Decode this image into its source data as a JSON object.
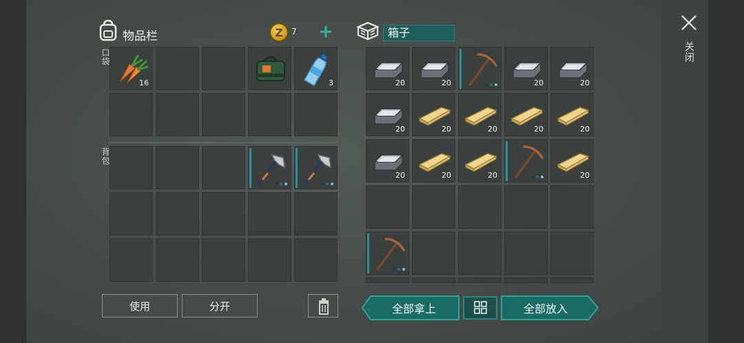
{
  "inventory": {
    "title": "物品栏",
    "coins": "7",
    "pocket_label": "口袋",
    "backpack_label": "背包",
    "pocket": [
      {
        "item": "carrot",
        "count": "16"
      },
      {
        "item": "",
        "count": ""
      },
      {
        "item": "",
        "count": ""
      },
      {
        "item": "supply-bag",
        "count": ""
      },
      {
        "item": "water-bottle",
        "count": "3"
      },
      {
        "item": "",
        "count": ""
      },
      {
        "item": "",
        "count": ""
      },
      {
        "item": "",
        "count": ""
      },
      {
        "item": "",
        "count": ""
      },
      {
        "item": "",
        "count": ""
      }
    ],
    "backpack": [
      {
        "item": "",
        "count": ""
      },
      {
        "item": "",
        "count": ""
      },
      {
        "item": "",
        "count": ""
      },
      {
        "item": "hatchet",
        "count": "",
        "durability": true
      },
      {
        "item": "hatchet",
        "count": "",
        "durability": true
      },
      {
        "item": "",
        "count": ""
      },
      {
        "item": "",
        "count": ""
      },
      {
        "item": "",
        "count": ""
      },
      {
        "item": "",
        "count": ""
      },
      {
        "item": "",
        "count": ""
      },
      {
        "item": "",
        "count": ""
      },
      {
        "item": "",
        "count": ""
      },
      {
        "item": "",
        "count": ""
      },
      {
        "item": "",
        "count": ""
      },
      {
        "item": "",
        "count": ""
      }
    ],
    "use_label": "使用",
    "split_label": "分开"
  },
  "box": {
    "name": "箱子",
    "slots": [
      {
        "item": "iron-ingot",
        "count": "20"
      },
      {
        "item": "iron-ingot",
        "count": "20"
      },
      {
        "item": "pickaxe",
        "count": "",
        "durability": true
      },
      {
        "item": "iron-ingot",
        "count": "20"
      },
      {
        "item": "iron-ingot",
        "count": "20"
      },
      {
        "item": "iron-ingot",
        "count": "20"
      },
      {
        "item": "plank",
        "count": "20"
      },
      {
        "item": "plank",
        "count": "20"
      },
      {
        "item": "plank",
        "count": "20"
      },
      {
        "item": "plank",
        "count": "20"
      },
      {
        "item": "iron-ingot",
        "count": "20"
      },
      {
        "item": "plank",
        "count": "20"
      },
      {
        "item": "plank",
        "count": "20"
      },
      {
        "item": "pickaxe",
        "count": "",
        "durability": true
      },
      {
        "item": "plank",
        "count": "20"
      },
      {
        "item": "",
        "count": ""
      },
      {
        "item": "",
        "count": ""
      },
      {
        "item": "",
        "count": ""
      },
      {
        "item": "",
        "count": ""
      },
      {
        "item": "",
        "count": ""
      },
      {
        "item": "pickaxe",
        "count": "",
        "durability": true
      },
      {
        "item": "",
        "count": ""
      },
      {
        "item": "",
        "count": ""
      },
      {
        "item": "",
        "count": ""
      },
      {
        "item": "",
        "count": ""
      }
    ],
    "take_all_label": "全部拿上",
    "put_all_label": "全部放入"
  },
  "close_label": "关闭",
  "colors": {
    "accent": "#2aa597",
    "accent_dark": "#1b6a63",
    "slot": "#3a403d",
    "background": "#4a514d"
  }
}
